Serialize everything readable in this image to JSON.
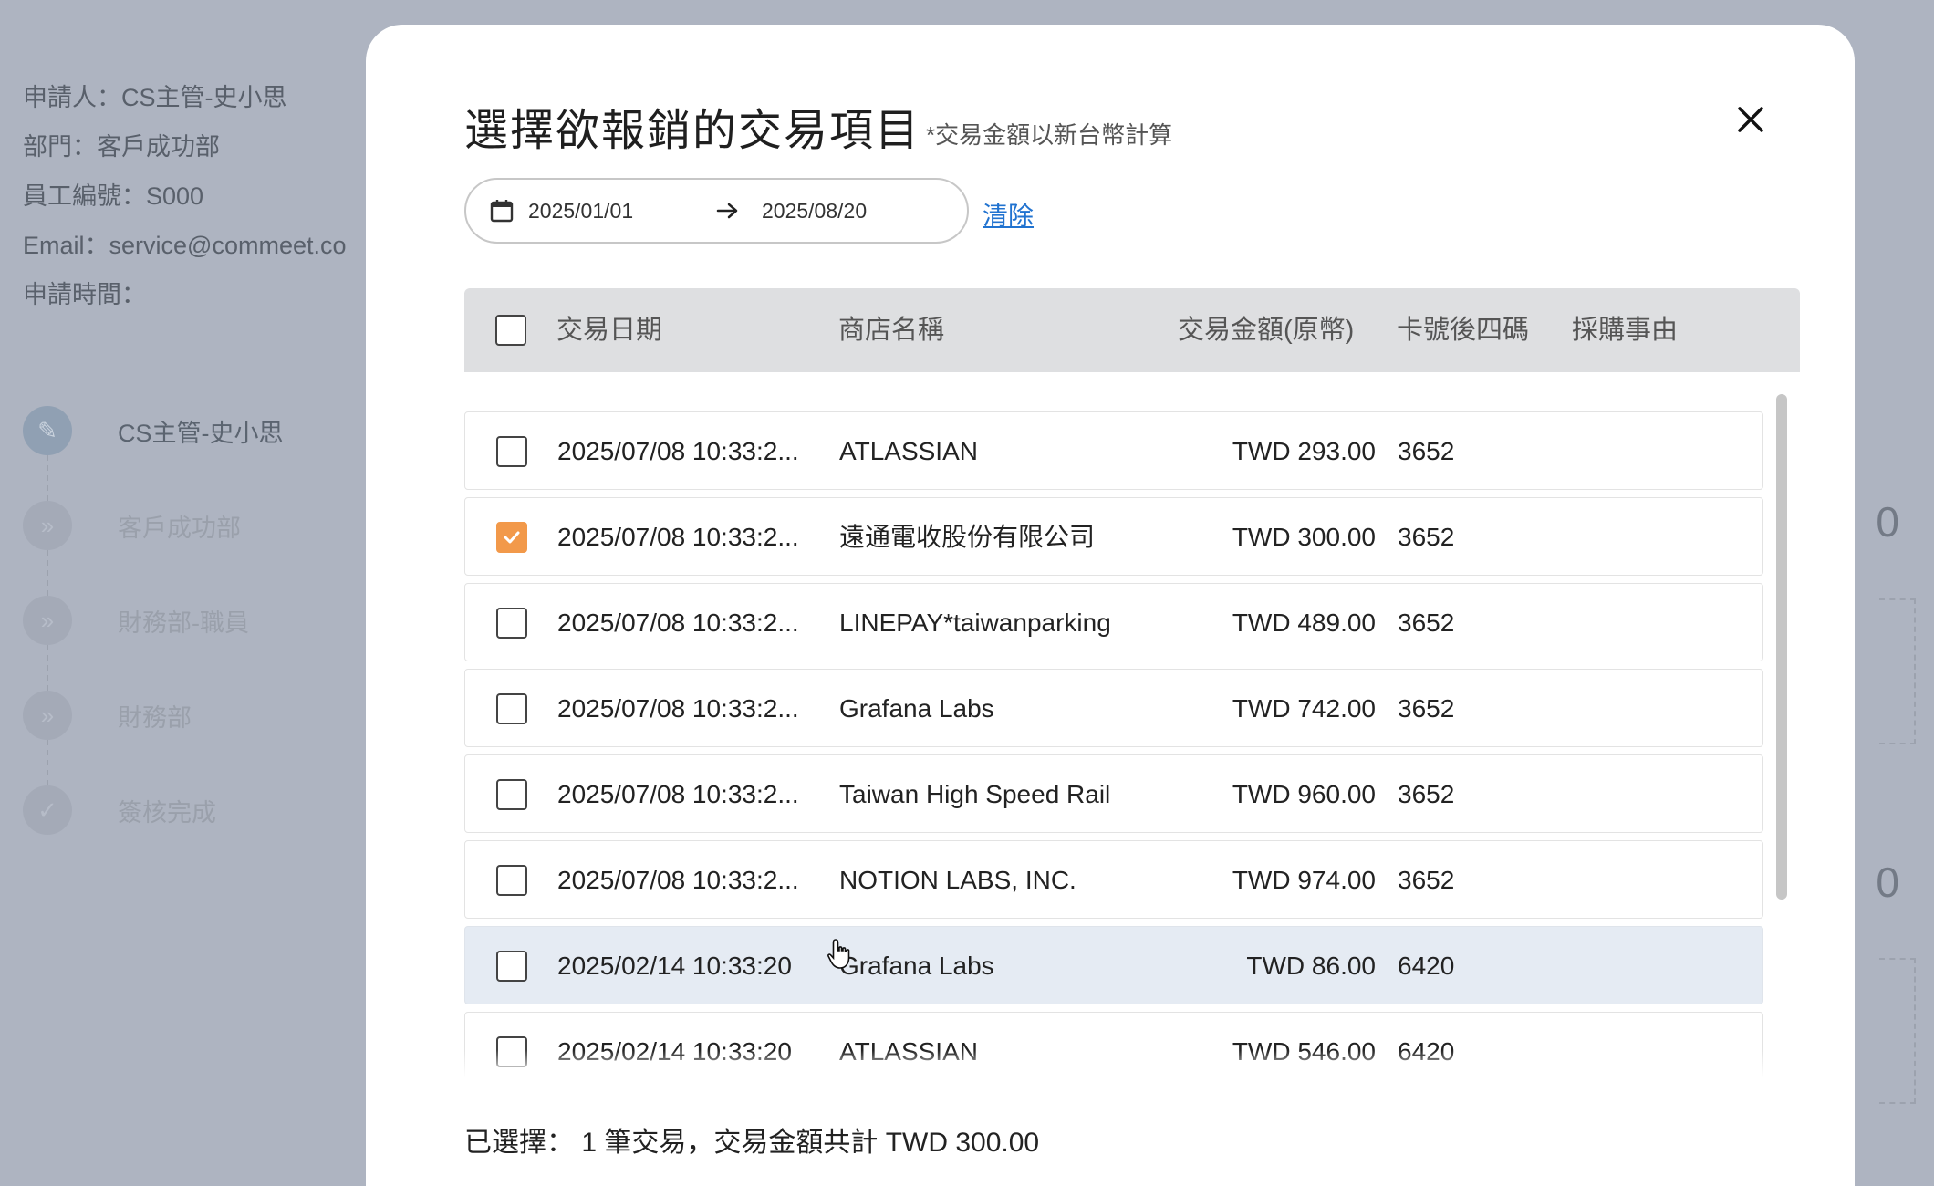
{
  "background": {
    "applicant": "申請人：CS主管-史小思",
    "department": "部門：客戶成功部",
    "employee_id": "員工編號：S000",
    "email": "Email：service@commeet.co",
    "apply_time": "申請時間：",
    "steps": [
      {
        "label": "CS主管-史小思",
        "icon": "pencil-icon",
        "active": true
      },
      {
        "label": "客戶成功部",
        "icon": "double-chevron-icon",
        "active": false
      },
      {
        "label": "財務部-職員",
        "icon": "double-chevron-icon",
        "active": false
      },
      {
        "label": "財務部",
        "icon": "double-chevron-icon",
        "active": false
      },
      {
        "label": "簽核完成",
        "icon": "check-icon",
        "active": false
      }
    ],
    "right_values": [
      "0",
      "0"
    ]
  },
  "modal": {
    "title": "選擇欲報銷的交易項目",
    "note": "*交易金額以新台幣計算",
    "close_icon": "close-icon",
    "date_range": {
      "start": "2025/01/01",
      "end": "2025/08/20"
    },
    "clear_label": "清除"
  },
  "table": {
    "columns": [
      "交易日期",
      "商店名稱",
      "交易金額(原幣)",
      "卡號後四碼",
      "採購事由"
    ],
    "rows": [
      {
        "date": "2025/07/08 10:33:2...",
        "merchant": "ATLASSIAN",
        "amount": "TWD 293.00",
        "card": "3652",
        "reason": "",
        "checked": false
      },
      {
        "date": "2025/07/08 10:33:2...",
        "merchant": "遠通電收股份有限公司",
        "amount": "TWD 300.00",
        "card": "3652",
        "reason": "",
        "checked": true
      },
      {
        "date": "2025/07/08 10:33:2...",
        "merchant": "LINEPAY*taiwanparking",
        "amount": "TWD 489.00",
        "card": "3652",
        "reason": "",
        "checked": false
      },
      {
        "date": "2025/07/08 10:33:2...",
        "merchant": "Grafana Labs",
        "amount": "TWD 742.00",
        "card": "3652",
        "reason": "",
        "checked": false
      },
      {
        "date": "2025/07/08 10:33:2...",
        "merchant": "Taiwan High Speed Rail",
        "amount": "TWD 960.00",
        "card": "3652",
        "reason": "",
        "checked": false
      },
      {
        "date": "2025/07/08 10:33:2...",
        "merchant": "NOTION LABS, INC.",
        "amount": "TWD 974.00",
        "card": "3652",
        "reason": "",
        "checked": false
      },
      {
        "date": "2025/02/14 10:33:20",
        "merchant": "Grafana Labs",
        "amount": "TWD 86.00",
        "card": "6420",
        "reason": "",
        "checked": false,
        "hovered": true
      },
      {
        "date": "2025/02/14 10:33:20",
        "merchant": "ATLASSIAN",
        "amount": "TWD 546.00",
        "card": "6420",
        "reason": "",
        "checked": false
      }
    ]
  },
  "summary": "已選擇： 1 筆交易，交易金額共計 TWD 300.00",
  "colors": {
    "accent_checkbox": "#f2994a",
    "link": "#2173d0",
    "hover_row": "#e5ebf3"
  }
}
